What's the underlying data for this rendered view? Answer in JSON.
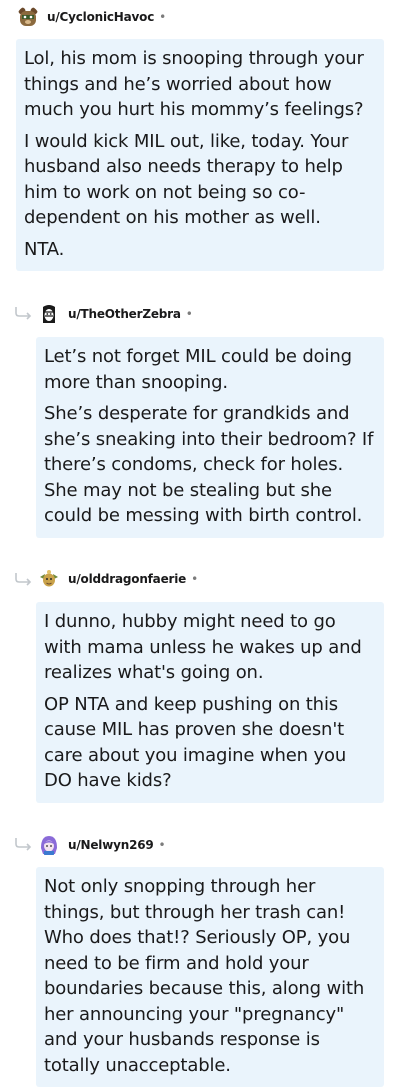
{
  "comments": [
    {
      "username": "u/CyclonicHavoc",
      "separator": "•",
      "avatar_icon": "bear-avatar-icon",
      "paragraphs": [
        "Lol, his mom is snooping through your things and he’s worried about how much you hurt his mommy’s feelings?",
        "I would kick MIL out, like, today. Your husband also needs therapy to help him to work on not being so co-dependent on his mother as well.",
        "NTA."
      ]
    },
    {
      "username": "u/TheOtherZebra",
      "separator": "•",
      "avatar_icon": "zebra-avatar-icon",
      "reply_icon": "reply-arrow-icon",
      "paragraphs": [
        "Let’s not forget MIL could be doing more than snooping.",
        "She’s desperate for grandkids and she’s sneaking into their bedroom? If there’s condoms, check for holes. She may not be stealing but she could be messing with birth control."
      ]
    },
    {
      "username": "u/olddragonfaerie",
      "separator": "•",
      "avatar_icon": "dragon-avatar-icon",
      "reply_icon": "reply-arrow-icon",
      "paragraphs": [
        "I dunno, hubby might need to go with mama unless he wakes up and realizes what's going on.",
        "OP NTA and keep pushing on this cause MIL has proven she doesn't care about you imagine when you DO have kids?"
      ]
    },
    {
      "username": "u/Nelwyn269",
      "separator": "•",
      "avatar_icon": "purple-hair-avatar-icon",
      "reply_icon": "reply-arrow-icon",
      "paragraphs": [
        "Not only snopping through her things, but through her trash can! Who does that!? Seriously OP, you need to be firm and hold your boundaries because this, along with her announcing your \"pregnancy\" and your husbands response is totally unacceptable."
      ]
    }
  ],
  "colors": {
    "bubble_bg": "#eaf4fc",
    "text": "#1a1a1b",
    "muted": "#7c7c7c"
  }
}
